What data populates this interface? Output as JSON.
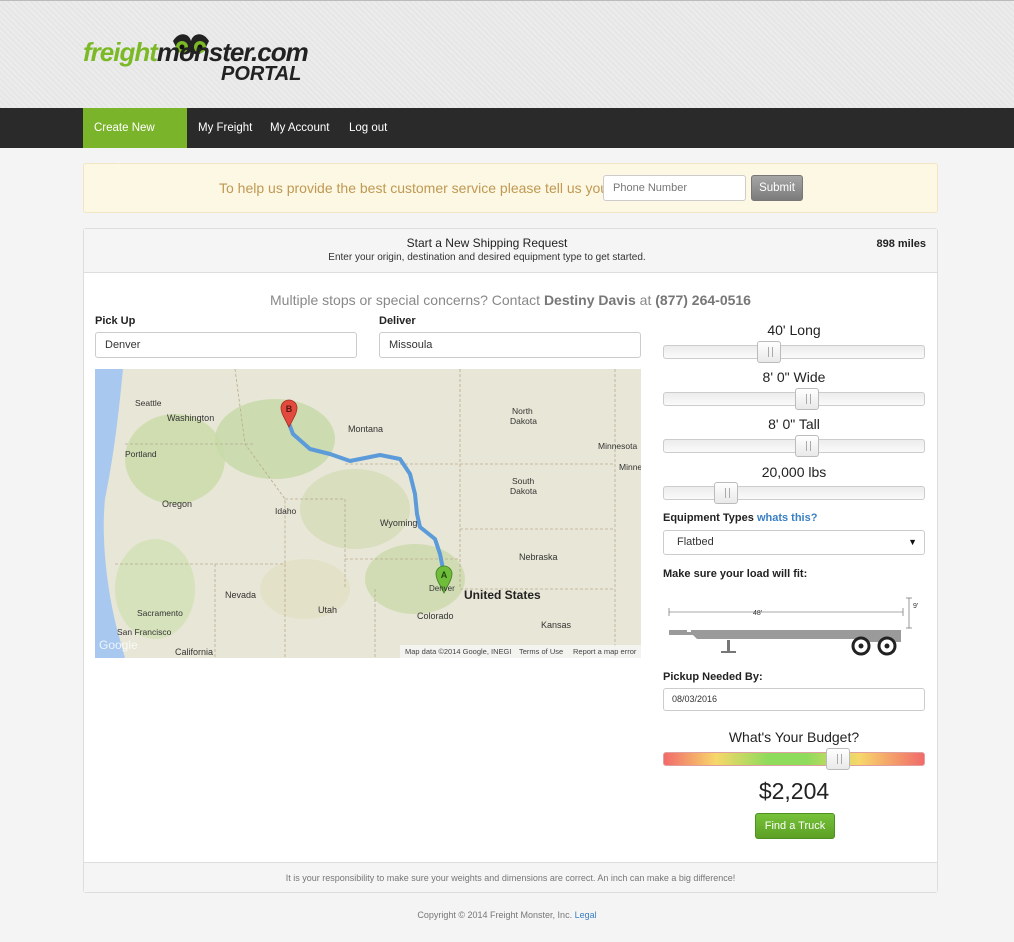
{
  "header": {
    "logo_part1": "freight",
    "logo_part2": "monster.com",
    "logo_part3": "PORTAL"
  },
  "nav": {
    "items": [
      {
        "label": "Create New Load",
        "active": true
      },
      {
        "label": "My Freight",
        "active": false
      },
      {
        "label": "My Account",
        "active": false
      },
      {
        "label": "Log out",
        "active": false
      }
    ]
  },
  "alert": {
    "message": "To help us provide the best customer service please tell us your",
    "phone_placeholder": "Phone Number",
    "submit_label": "Submit"
  },
  "panel": {
    "title": "Start a New Shipping Request",
    "subtitle": "Enter your origin, destination and desired equipment type to get started.",
    "distance": "898 miles",
    "contact": {
      "prefix": "Multiple stops or special concerns? Contact",
      "name": "Destiny Davis",
      "at": "at",
      "phone": "(877) 264-0516"
    },
    "pickup": {
      "label": "Pick Up",
      "value": "Denver"
    },
    "deliver": {
      "label": "Deliver",
      "value": "Missoula"
    },
    "footer_note": "It is your responsibility to make sure your weights and dimensions are correct. An inch can make a big difference!"
  },
  "map": {
    "origin_marker": "A",
    "destination_marker": "B",
    "labels": {
      "seattle": "Seattle",
      "washington": "Washington",
      "portland": "Portland",
      "oregon": "Oregon",
      "idaho": "Idaho",
      "montana": "Montana",
      "wyoming": "Wyoming",
      "north_dakota_1": "North",
      "north_dakota_2": "Dakota",
      "south_dakota_1": "South",
      "south_dakota_2": "Dakota",
      "minnesota": "Minnesota",
      "minn": "Minne",
      "nebraska": "Nebraska",
      "nevada": "Nevada",
      "utah": "Utah",
      "colorado": "Colorado",
      "denver": "Denver",
      "united_states": "United States",
      "kansas": "Kansas",
      "sacramento": "Sacramento",
      "san_francisco": "San Francisco",
      "california": "California",
      "google": "Google"
    },
    "attribution": {
      "data": "Map data ©2014 Google, INEGI",
      "terms": "Terms of Use",
      "report": "Report a map error"
    }
  },
  "sliders": {
    "length": {
      "label": "40' Long",
      "value_fraction": 0.39
    },
    "width": {
      "label": "8' 0\" Wide",
      "value_fraction": 0.55
    },
    "height": {
      "label": "8' 0\" Tall",
      "value_fraction": 0.55
    },
    "weight": {
      "label": "20,000 lbs",
      "value_fraction": 0.21
    }
  },
  "equipment": {
    "label": "Equipment Types",
    "help_link": "whats this?",
    "selected": "Flatbed",
    "caret": "▼"
  },
  "fit": {
    "label": "Make sure your load will fit:",
    "length_dim": "48'",
    "height_dim": "9'"
  },
  "pickup_date": {
    "label": "Pickup Needed By:",
    "value": "08/03/2016"
  },
  "budget": {
    "label": "What's Your Budget?",
    "value_fraction": 0.68,
    "amount": "$2,204",
    "button": "Find a Truck"
  },
  "footer": {
    "copyright": "Copyright © 2014 Freight Monster, Inc.",
    "legal_link": "Legal"
  },
  "colors": {
    "brand_green": "#7ab42a",
    "nav_bg": "#2a2a2a",
    "route_blue": "#5b9bd9",
    "link_blue": "#3a7fc4"
  }
}
